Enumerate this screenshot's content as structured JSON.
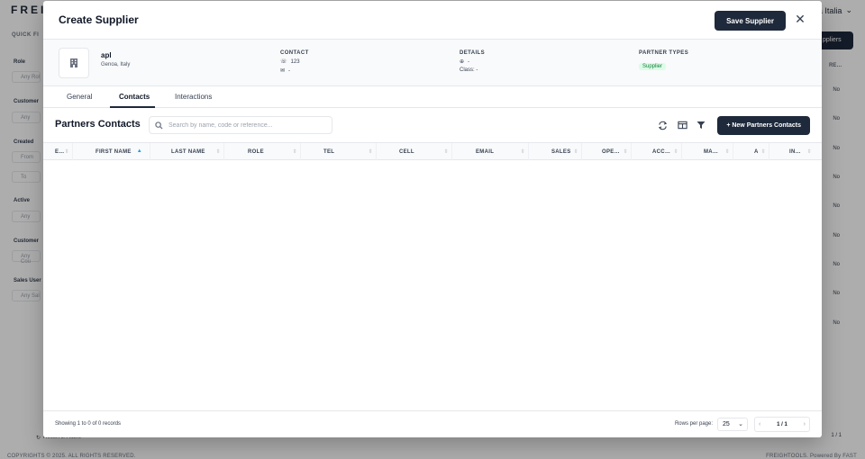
{
  "background": {
    "logo": "FREI",
    "company_selector": "a Italia",
    "quick_filters_label": "QUICK FI",
    "filters": [
      {
        "label": "Role",
        "placeholder": "Any Rol"
      },
      {
        "label": "Customer",
        "placeholder": "Any"
      },
      {
        "label": "Created",
        "placeholder": "From"
      },
      {
        "label": "",
        "placeholder": "To"
      },
      {
        "label": "Active",
        "placeholder": "Any"
      },
      {
        "label": "Customer",
        "placeholder": "Any Cou"
      },
      {
        "label": "Sales User",
        "placeholder": "Any Sal"
      }
    ],
    "suppliers_button": "ppliers",
    "column_head": "RE…",
    "row_values": [
      "No",
      "No",
      "No",
      "No",
      "No",
      "No",
      "No",
      "No",
      "No"
    ],
    "reset_filters": "Reset All Filters",
    "pager_text": "1 / 1",
    "copyright": "COPYRIGHTS © 2025. ALL RIGHTS RESERVED.",
    "powered_by": "FREIGHTOOLS. Powered By FAST"
  },
  "modal": {
    "title": "Create Supplier",
    "save_label": "Save Supplier",
    "close_icon": "close-icon",
    "company": {
      "name": "apl",
      "location": "Genoa, Italy",
      "avatar_icon": "building-icon"
    },
    "contact": {
      "heading": "CONTACT",
      "phone": "123",
      "email": "-"
    },
    "details": {
      "heading": "DETAILS",
      "web": "-",
      "class": "Class: -"
    },
    "partner_types": {
      "heading": "PARTNER TYPES",
      "badge": "Supplier"
    },
    "tabs": [
      {
        "label": "General",
        "active": false
      },
      {
        "label": "Contacts",
        "active": true
      },
      {
        "label": "Interactions",
        "active": false
      }
    ],
    "contacts": {
      "title": "Partners Contacts",
      "search_placeholder": "Search by name, code or reference...",
      "new_button": "+  New Partners Contacts",
      "columns": [
        "E…",
        "FIRST NAME",
        "LAST NAME",
        "ROLE",
        "TEL",
        "CELL",
        "EMAIL",
        "SALES",
        "OPE…",
        "ACC…",
        "MA…",
        "A",
        "IN…"
      ],
      "sorted_column": "FIRST NAME",
      "records_text": "Showing 1 to 0 of 0 records",
      "rows_per_page_label": "Rows per page:",
      "rows_per_page": "25",
      "page": "1 / 1"
    }
  },
  "colors": {
    "primary": "#1e293b",
    "badge_bg": "#dcfce7",
    "badge_text": "#15803d",
    "sort_accent": "#0ea5e9"
  }
}
